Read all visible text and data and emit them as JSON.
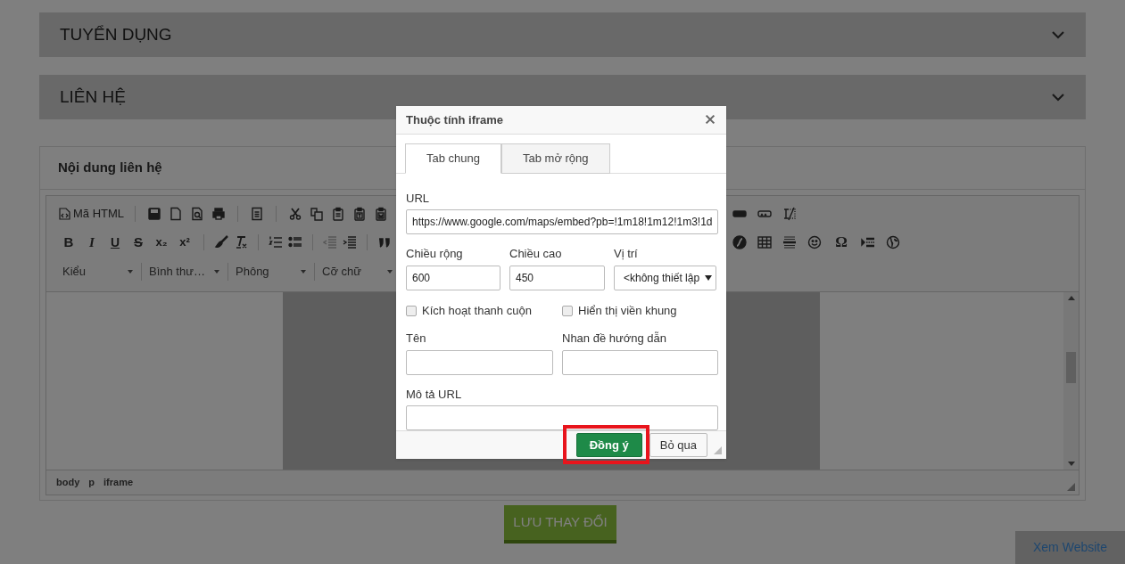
{
  "accordions": [
    {
      "title": "TUYỂN DỤNG"
    },
    {
      "title": "LIÊN HỆ"
    }
  ],
  "panel": {
    "title": "Nội dung liên hệ"
  },
  "editor": {
    "source_button": "Mã HTML",
    "glyphs": [
      "B",
      "I",
      "U",
      "S",
      "x₂",
      "x²",
      "Ω"
    ],
    "dropdowns": [
      "Kiểu",
      "Bình thư…",
      "Phông",
      "Cỡ chữ"
    ],
    "path": [
      "body",
      "p",
      "iframe"
    ]
  },
  "save_button": "LƯU THAY ĐỔI",
  "view_site": "Xem Website",
  "dialog": {
    "title": "Thuộc tính iframe",
    "tabs": [
      {
        "label": "Tab chung",
        "selected": true
      },
      {
        "label": "Tab mở rộng",
        "selected": false
      }
    ],
    "url": {
      "label": "URL",
      "value": "https://www.google.com/maps/embed?pb=!1m18!1m12!1m3!1d"
    },
    "width": {
      "label": "Chiều rộng",
      "value": "600"
    },
    "height": {
      "label": "Chiều cao",
      "value": "450"
    },
    "align": {
      "label": "Vị trí",
      "value": "<không thiết lập"
    },
    "checkboxes": [
      {
        "label": "Kích hoạt thanh cuộn",
        "checked": false
      },
      {
        "label": "Hiển thị viền khung",
        "checked": false
      }
    ],
    "name": {
      "label": "Tên"
    },
    "tooltip": {
      "label": "Nhan đề hướng dẫn"
    },
    "long_desc": {
      "label": "Mô tả URL"
    },
    "buttons": [
      {
        "label": "Đồng ý",
        "kind": "primary"
      },
      {
        "label": "Bỏ qua",
        "kind": "secondary"
      }
    ]
  }
}
